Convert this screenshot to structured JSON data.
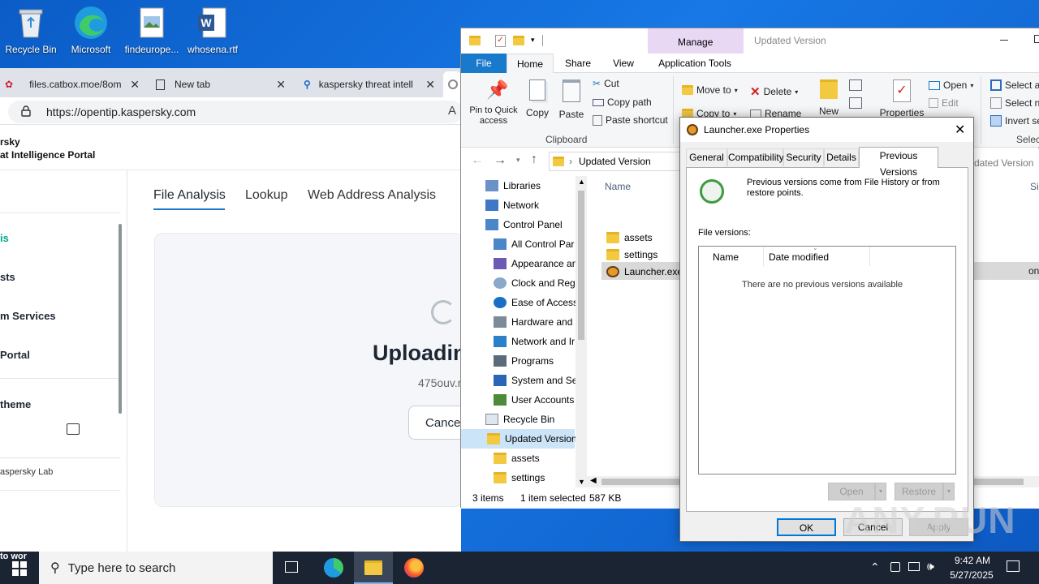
{
  "desktop": {
    "icons": [
      {
        "label": "Recycle Bin"
      },
      {
        "label": "Microsoft"
      },
      {
        "label": "findeurope..."
      },
      {
        "label": "whosena.rtf"
      }
    ]
  },
  "browser": {
    "tabs": [
      {
        "title": "files.catbox.moe/8om"
      },
      {
        "title": "New tab"
      },
      {
        "title": "kaspersky threat intelli"
      }
    ],
    "url": "https://opentip.kaspersky.com",
    "brand_line1": "rsky",
    "brand_line2": "at Intelligence Portal",
    "sidebar": {
      "items": [
        {
          "label": "is"
        },
        {
          "label": "sts"
        },
        {
          "label": "m Services"
        },
        {
          "label": "Portal"
        },
        {
          "label": "theme"
        }
      ],
      "footer": "aspersky Lab"
    },
    "nav_tabs": [
      {
        "label": "File Analysis"
      },
      {
        "label": "Lookup"
      },
      {
        "label": "Web Address Analysis"
      }
    ],
    "upload": {
      "title": "Uploadin",
      "filename": "475ouv.r",
      "cancel": "Cance"
    }
  },
  "explorer": {
    "title": "Updated Version",
    "context_tab_group": "Manage",
    "ribbon_tabs": [
      {
        "label": "File"
      },
      {
        "label": "Home"
      },
      {
        "label": "Share"
      },
      {
        "label": "View"
      },
      {
        "label": "Application Tools"
      }
    ],
    "clipboard": {
      "pin": "Pin to Quick access",
      "copy": "Copy",
      "paste": "Paste",
      "cut": "Cut",
      "copy_path": "Copy path",
      "paste_shortcut": "Paste shortcut",
      "group_label": "Clipboard"
    },
    "organize": {
      "move_to": "Move to",
      "delete": "Delete",
      "copy_to": "Copy to",
      "rename": "Rename"
    },
    "new_label": "New",
    "properties_label": "Properties",
    "open_group": {
      "open": "Open",
      "edit": "Edit"
    },
    "select_group": {
      "select_all": "Select al",
      "select_none": "Select n",
      "invert": "Invert se",
      "group_label": "Selec"
    },
    "address_path": "Updated Version",
    "address_path_right": "dated Version",
    "nav_items": [
      {
        "label": "Libraries",
        "icon": "libraries-icon"
      },
      {
        "label": "Network",
        "icon": "network-icon"
      },
      {
        "label": "Control Panel",
        "icon": "control-panel-icon"
      },
      {
        "label": "All Control Par",
        "icon": "control-panel-icon"
      },
      {
        "label": "Appearance an",
        "icon": "appearance-icon"
      },
      {
        "label": "Clock and Regi",
        "icon": "clock-icon"
      },
      {
        "label": "Ease of Access",
        "icon": "ease-of-access-icon"
      },
      {
        "label": "Hardware and",
        "icon": "hardware-icon"
      },
      {
        "label": "Network and Ir",
        "icon": "network-internet-icon"
      },
      {
        "label": "Programs",
        "icon": "programs-icon"
      },
      {
        "label": "System and Sec",
        "icon": "system-security-icon"
      },
      {
        "label": "User Accounts",
        "icon": "user-accounts-icon"
      },
      {
        "label": "Recycle Bin",
        "icon": "recycle-bin-icon"
      },
      {
        "label": "Updated Version",
        "icon": "folder-icon"
      },
      {
        "label": "assets",
        "icon": "folder-icon"
      },
      {
        "label": "settings",
        "icon": "folder-icon"
      }
    ],
    "column_name": "Name",
    "files": [
      {
        "name": "assets"
      },
      {
        "name": "settings"
      },
      {
        "name": "Launcher.exe"
      }
    ],
    "right_partial": {
      "size_header": "Siz",
      "selected_tail": "on"
    },
    "status": {
      "items": "3 items",
      "selected": "1 item selected",
      "size": "587 KB"
    }
  },
  "properties": {
    "title": "Launcher.exe Properties",
    "tabs": [
      {
        "label": "General"
      },
      {
        "label": "Compatibility"
      },
      {
        "label": "Security"
      },
      {
        "label": "Details"
      },
      {
        "label": "Previous Versions"
      }
    ],
    "info": "Previous versions come from File History or from restore points.",
    "file_versions_label": "File versions:",
    "columns": [
      {
        "label": "Name"
      },
      {
        "label": "Date modified"
      }
    ],
    "empty_message": "There are no previous versions available",
    "buttons": {
      "open": "Open",
      "restore": "Restore",
      "ok": "OK",
      "cancel": "Cancel",
      "apply": "Apply"
    }
  },
  "taskbar": {
    "search_placeholder": "Type here to search",
    "time": "9:42 AM",
    "date": "5/27/2025",
    "left_stub": "to wor"
  },
  "watermark": "ANY.RUN",
  "colors": {
    "accent": "#1979ca",
    "kaspersky_green": "#00a88e",
    "explorer_file_tab": "#1979ca",
    "manage_tab": "#e9d8f4"
  }
}
